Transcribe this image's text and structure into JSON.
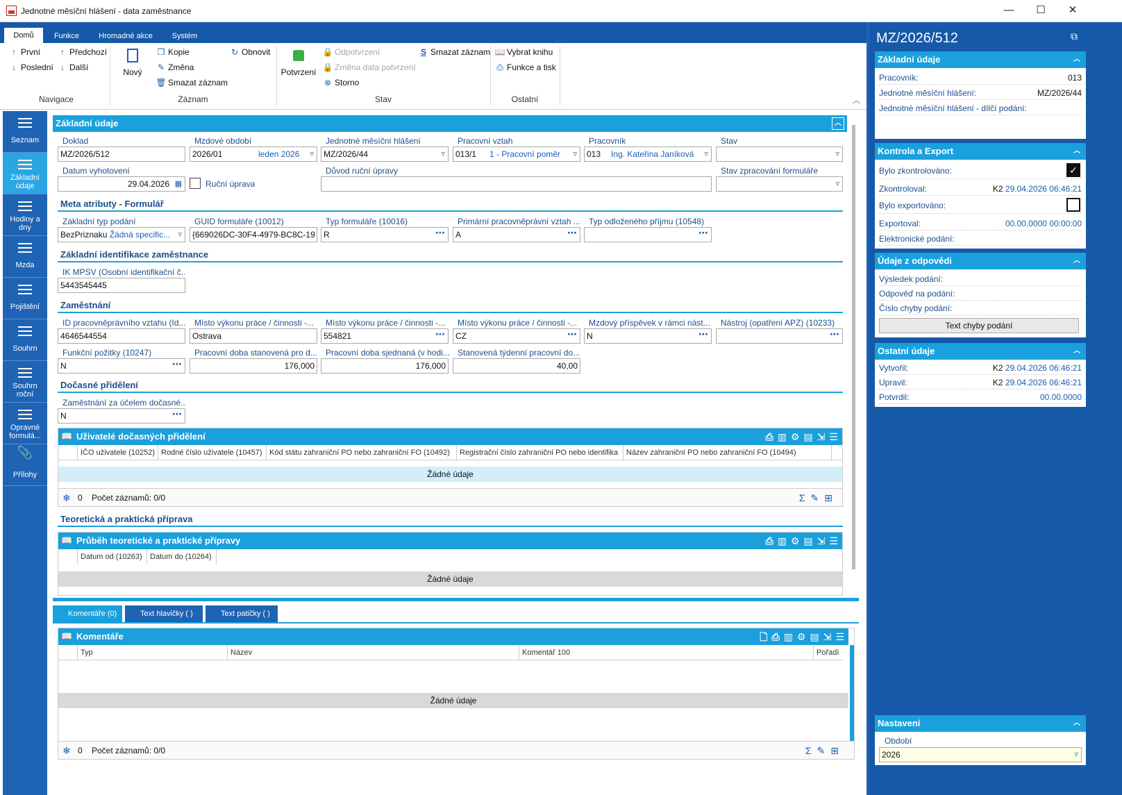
{
  "window": {
    "title": "Jednotné měsíční hlášení - data zaměstnance",
    "min": "—",
    "max": "☐",
    "close": "✕"
  },
  "ribbon": {
    "tabs": [
      "Domů",
      "Funkce",
      "Hromadné akce",
      "Systém"
    ],
    "nav": {
      "first": "První",
      "prev": "Předchozí",
      "last": "Poslední",
      "next": "Další",
      "group": "Navigace"
    },
    "record": {
      "new": "Nový",
      "copy": "Kopie",
      "change": "Změna",
      "delete": "Smazat záznam",
      "refresh": "Obnovit",
      "group": "Záznam"
    },
    "state": {
      "confirm": "Potvrzení",
      "unconfirm": "Odpotvrzení",
      "change_date": "Změna data potvrzení",
      "storno": "Storno",
      "delete_record": "Smazat záznam",
      "group": "Stav"
    },
    "other": {
      "book": "Vybrat knihu",
      "print": "Funkce a tisk",
      "group": "Ostatní"
    }
  },
  "leftnav": [
    "Seznam",
    "Základní údaje",
    "Hodiny a dny",
    "Mzda",
    "Pojištění",
    "Souhrn",
    "Souhrn roční",
    "Opravné formulá...",
    "Přílohy"
  ],
  "form": {
    "section": "Základní údaje",
    "doklad": {
      "label": "Doklad",
      "value": "MZ/2026/512"
    },
    "mzdove": {
      "label": "Mzdové období",
      "value": "2026/01",
      "text": "leden 2026"
    },
    "jmh": {
      "label": "Jednotné měsíční hlášení",
      "value": "MZ/2026/44"
    },
    "pv": {
      "label": "Pracovní vztah",
      "value": "013/1",
      "text": "1 - Pracovní poměr"
    },
    "pracovnik": {
      "label": "Pracovník",
      "value": "013",
      "text": "Ing. Kateřina Janíková"
    },
    "stav": {
      "label": "Stav",
      "value": ""
    },
    "datum": {
      "label": "Datum vyhotovení",
      "value": "29.04.2026"
    },
    "rucni": {
      "label": "Ruční úprava"
    },
    "duvod": {
      "label": "Důvod ruční úpravy",
      "value": ""
    },
    "stavzprac": {
      "label": "Stav zpracování formuláře",
      "value": ""
    },
    "meta": {
      "title": "Meta atributy - Formulář",
      "f1": {
        "label": "Základní typ podání",
        "value": "BezPriznaku",
        "text": "Žádná specific..."
      },
      "f2": {
        "label": "GUID formuláře (10012)",
        "value": "{669026DC-30F4-4979-BC8C-19"
      },
      "f3": {
        "label": "Typ formuláře (10016)",
        "value": "R"
      },
      "f4": {
        "label": "Primární pracovněprávní vztah ...",
        "value": "A"
      },
      "f5": {
        "label": "Typ odloženého příjmu (10548)",
        "value": ""
      }
    },
    "ident": {
      "title": "Základní identifikace zaměstnance",
      "ik": {
        "label": "IK MPSV (Osobní identifikační č...",
        "value": "5443545445"
      }
    },
    "zam": {
      "title": "Zaměstnání",
      "z1": {
        "label": "ID pracovněprávního vztahu (Id...",
        "value": "4646544554"
      },
      "z2": {
        "label": "Místo výkonu práce / činnosti -...",
        "value": "Ostrava"
      },
      "z3": {
        "label": "Místo výkonu práce / činnosti -...",
        "value": "554821"
      },
      "z4": {
        "label": "Místo výkonu práce / činnosti -...",
        "value": "CZ"
      },
      "z5": {
        "label": "Mzdový příspěvek v rámci nást...",
        "value": "N"
      },
      "z6": {
        "label": "Nástroj (opatření APZ) (10233)",
        "value": ""
      },
      "z7": {
        "label": "Funkční požitky (10247)",
        "value": "N"
      },
      "z8": {
        "label": "Pracovní doba stanovená pro d...",
        "value": "176,000"
      },
      "z9": {
        "label": "Pracovní doba sjednaná (v hodi...",
        "value": "176,000"
      },
      "z10": {
        "label": "Stanovená týdenní pracovní do...",
        "value": "40,00"
      }
    },
    "doc": {
      "title": "Dočasné přidělení",
      "d1": {
        "label": "Zaměstnání za účelem dočasné...",
        "value": "N"
      }
    },
    "grid1": {
      "title": "Uživatelé dočasných přidělení",
      "cols": [
        "IČO uživatele (10252)",
        "Rodné číslo uživatele (10457)",
        "Kód státu zahraniční PO nebo zahraniční FO (10492)",
        "Registrační číslo zahraniční PO nebo identifika",
        "Název zahraniční PO nebo zahraniční FO (10494)"
      ],
      "empty": "Žádné údaje",
      "count": "0",
      "records": "Počet záznamů: 0/0"
    },
    "teor": {
      "title": "Teoretická a praktická příprava"
    },
    "grid2": {
      "title": "Průběh teoretické a praktické přípravy",
      "cols": [
        "Datum od (10263)",
        "Datum do (10264)"
      ],
      "empty": "Žádné údaje"
    }
  },
  "bottom": {
    "tabs": [
      "Komentáře (0)",
      "Text hlavičky ( )",
      "Text patičky ( )"
    ],
    "grid": {
      "title": "Komentáře",
      "cols": [
        "Typ",
        "Název",
        "Komentář 100",
        "Pořadí"
      ],
      "empty": "Žádné údaje",
      "count": "0",
      "records": "Počet záznamů: 0/0"
    }
  },
  "right": {
    "title": "MZ/2026/512",
    "zakl": {
      "title": "Základní údaje",
      "r1": {
        "k": "Pracovník:",
        "v": "013"
      },
      "r2": {
        "k": "Jednotné měsíční hlášení:",
        "v": "MZ/2026/44"
      },
      "r3": {
        "k": "Jednotné měsíční hlášení - dílčí podání:",
        "v": ""
      }
    },
    "kontrola": {
      "title": "Kontrola a Export",
      "r1": {
        "k": "Bylo zkontrolováno:"
      },
      "r2": {
        "k": "Zkontroloval:",
        "u": "K2",
        "d": "29.04.2026 06:46:21"
      },
      "r3": {
        "k": "Bylo exportováno:"
      },
      "r4": {
        "k": "Exportoval:",
        "d": "00.00.0000 00:00:00"
      },
      "r5": {
        "k": "Elektronické podání:"
      }
    },
    "odpoved": {
      "title": "Údaje z odpovědi",
      "r1": "Výsledek podání:",
      "r2": "Odpověď na podání:",
      "r3": "Číslo chyby podání:",
      "btn": "Text chyby podání"
    },
    "ostatni": {
      "title": "Ostatní údaje",
      "r1": {
        "k": "Vytvořil:",
        "u": "K2",
        "d": "29.04.2026 06:46:21"
      },
      "r2": {
        "k": "Upravil:",
        "u": "K2",
        "d": "29.04.2026 06:46:21"
      },
      "r3": {
        "k": "Potvrdil:",
        "d": "00.00.0000"
      }
    },
    "nastaveni": {
      "title": "Nastavení",
      "obdobi": {
        "label": "Období",
        "value": "2026"
      }
    }
  }
}
